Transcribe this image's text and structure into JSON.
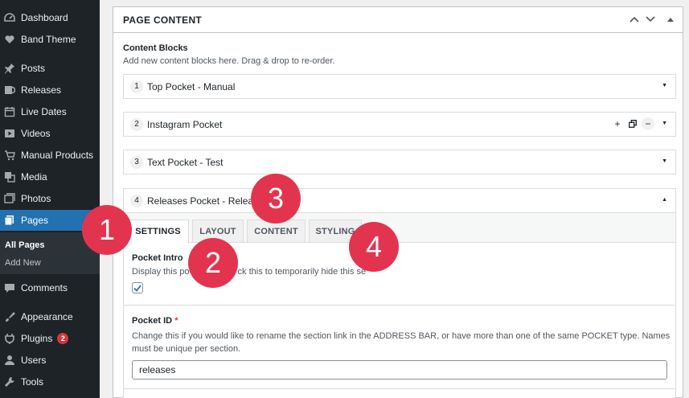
{
  "sidebar": {
    "items": [
      {
        "label": "Dashboard",
        "icon": "dashboard-icon"
      },
      {
        "label": "Band Theme",
        "icon": "heart-icon"
      },
      {
        "label": "Posts",
        "icon": "pin-icon"
      },
      {
        "label": "Releases",
        "icon": "album-icon"
      },
      {
        "label": "Live Dates",
        "icon": "calendar-icon"
      },
      {
        "label": "Videos",
        "icon": "video-icon"
      },
      {
        "label": "Manual Products",
        "icon": "cart-icon"
      },
      {
        "label": "Media",
        "icon": "media-icon"
      },
      {
        "label": "Photos",
        "icon": "photos-icon"
      },
      {
        "label": "Pages",
        "icon": "pages-icon"
      },
      {
        "label": "Comments",
        "icon": "comment-icon"
      },
      {
        "label": "Appearance",
        "icon": "brush-icon"
      },
      {
        "label": "Plugins",
        "icon": "plugin-icon",
        "badge": "2"
      },
      {
        "label": "Users",
        "icon": "user-icon"
      },
      {
        "label": "Tools",
        "icon": "wrench-icon"
      }
    ],
    "submenu": [
      "All Pages",
      "Add New"
    ]
  },
  "panel": {
    "title": "PAGE CONTENT",
    "blocks_label": "Content Blocks",
    "blocks_desc": "Add new content blocks here. Drag & drop to re-order."
  },
  "blocks": [
    {
      "num": "1",
      "title": "Top Pocket - Manual"
    },
    {
      "num": "2",
      "title": "Instagram Pocket"
    },
    {
      "num": "3",
      "title": "Text Pocket - Test"
    },
    {
      "num": "4",
      "title": "Releases Pocket - Releas"
    }
  ],
  "tabs": [
    "SETTINGS",
    "LAYOUT",
    "CONTENT",
    "STYLING"
  ],
  "fields": {
    "intro_label": "Pocket Intro",
    "intro_desc_a": "Display this po",
    "intro_desc_b": "ck this to temporarily hide this se",
    "intro_checked": true,
    "id_label": "Pocket ID",
    "id_required": "*",
    "id_desc": "Change this if you would like to rename the section link in the ADDRESS BAR, or have more than one of the same POCKET type. Names must be unique per section.",
    "id_value": "releases"
  },
  "callouts": [
    "1",
    "2",
    "3",
    "4"
  ],
  "colors": {
    "sidebar": "#1d2327",
    "accent": "#2271b1",
    "callout": "#e3344f",
    "badge": "#d63638"
  }
}
